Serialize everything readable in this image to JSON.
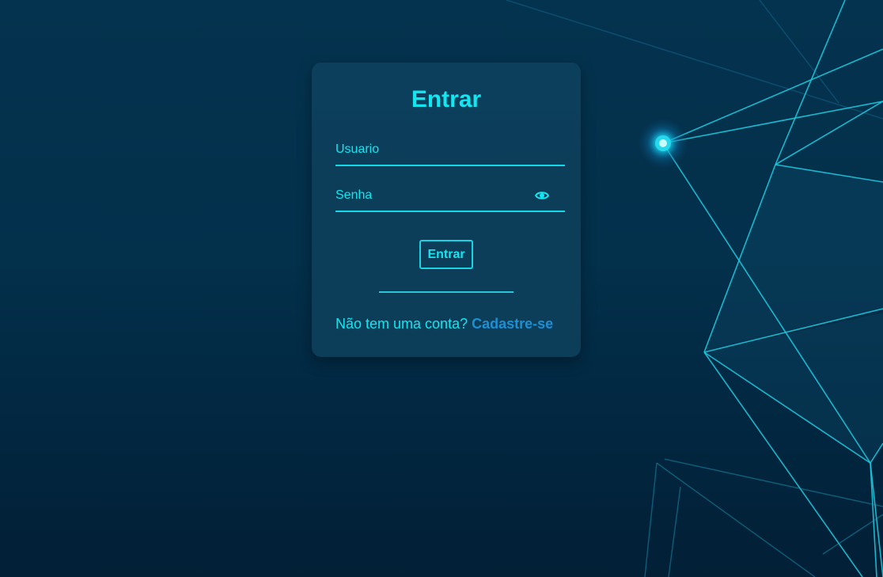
{
  "login": {
    "title": "Entrar",
    "username_placeholder": "Usuario",
    "username_value": "",
    "password_placeholder": "Senha",
    "password_value": "",
    "submit_label": "Entrar",
    "signup_prompt": "Não tem uma conta?",
    "signup_link": "Cadastre-se",
    "password_toggle_icon": "eye-icon"
  },
  "colors": {
    "accent": "#12e6f0",
    "link": "#1d8fd3",
    "background": "#03304b",
    "card": "#10425f"
  }
}
